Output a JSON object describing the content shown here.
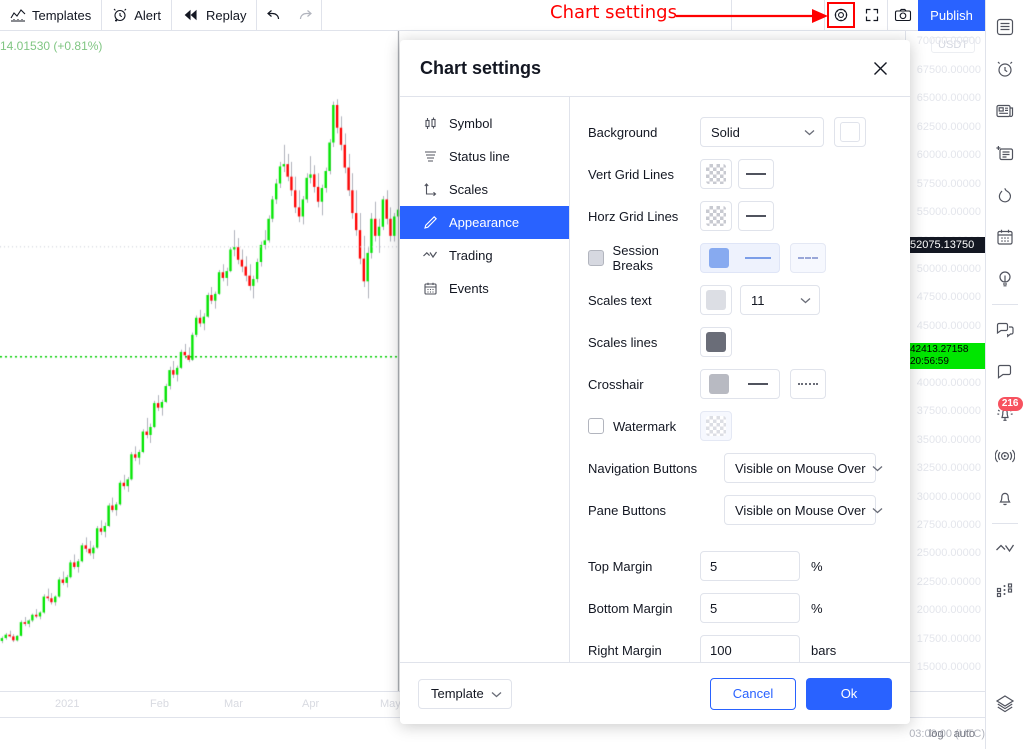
{
  "toolbar": {
    "templates_label": "Templates",
    "alert_label": "Alert",
    "replay_label": "Replay",
    "publish_label": "Publish"
  },
  "annotation": {
    "text": "Chart settings",
    "color": "#ff0000"
  },
  "chart": {
    "ticker_quote": "14.01530 (+0.81%)",
    "quote_color": "#80c683",
    "currency_chip": "USDT",
    "crosshair_price": "52075.13750",
    "last_price": "42413.27158",
    "last_price_time": "20:56:59",
    "last_price_color": "#00e600",
    "log_label": "log",
    "auto_label": "auto",
    "clock_time": "03:03:00 (UTC)"
  },
  "chart_data": {
    "type": "candlestick",
    "title": "",
    "xlabel": "",
    "ylabel": "",
    "ylim": [
      13000,
      71000
    ],
    "y_ticks": [
      "70000.00000",
      "67500.00000",
      "65000.00000",
      "62500.00000",
      "60000.00000",
      "57500.00000",
      "55000.00000",
      "52500.00000",
      "50000.00000",
      "47500.00000",
      "45000.00000",
      "42500.00000",
      "40000.00000",
      "37500.00000",
      "35000.00000",
      "32500.00000",
      "30000.00000",
      "27500.00000",
      "25000.00000",
      "22500.00000",
      "20000.00000",
      "17500.00000",
      "15000.00000"
    ],
    "x_ticks": [
      "2021",
      "Feb",
      "Mar",
      "Apr",
      "May"
    ],
    "up_color": "#00e600",
    "down_color": "#ff0000",
    "candles": [
      [
        17400,
        17800,
        17200,
        17650
      ],
      [
        17650,
        18100,
        17500,
        17950
      ],
      [
        17950,
        18300,
        17700,
        17800
      ],
      [
        17800,
        18000,
        17300,
        17450
      ],
      [
        17450,
        17900,
        17350,
        17850
      ],
      [
        17850,
        19200,
        17800,
        19050
      ],
      [
        19050,
        19500,
        18700,
        18900
      ],
      [
        18900,
        19300,
        18600,
        19200
      ],
      [
        19200,
        19800,
        19050,
        19700
      ],
      [
        19700,
        20200,
        19400,
        19550
      ],
      [
        19550,
        20000,
        19300,
        19900
      ],
      [
        19900,
        21500,
        19800,
        21300
      ],
      [
        21300,
        22000,
        20900,
        21150
      ],
      [
        21150,
        21600,
        20600,
        20800
      ],
      [
        20800,
        21400,
        20500,
        21300
      ],
      [
        21300,
        23000,
        21200,
        22800
      ],
      [
        22800,
        23500,
        22300,
        22500
      ],
      [
        22500,
        23200,
        22100,
        23000
      ],
      [
        23000,
        24500,
        22900,
        24300
      ],
      [
        24300,
        25000,
        23700,
        23900
      ],
      [
        23900,
        24600,
        23400,
        24400
      ],
      [
        24400,
        26000,
        24300,
        25800
      ],
      [
        25800,
        26500,
        25200,
        25500
      ],
      [
        25500,
        26200,
        24900,
        25100
      ],
      [
        25100,
        25800,
        24600,
        25600
      ],
      [
        25600,
        27500,
        25500,
        27300
      ],
      [
        27300,
        28000,
        26700,
        27000
      ],
      [
        27000,
        27800,
        26500,
        27500
      ],
      [
        27500,
        29500,
        27400,
        29300
      ],
      [
        29300,
        30000,
        28700,
        28900
      ],
      [
        28900,
        29600,
        28400,
        29400
      ],
      [
        29400,
        31500,
        29300,
        31300
      ],
      [
        31300,
        32000,
        30700,
        31000
      ],
      [
        31000,
        31800,
        30500,
        31600
      ],
      [
        31600,
        34000,
        31500,
        33800
      ],
      [
        33800,
        34500,
        33200,
        33500
      ],
      [
        33500,
        34200,
        32900,
        34000
      ],
      [
        34000,
        36000,
        33900,
        35800
      ],
      [
        35800,
        37000,
        35200,
        35500
      ],
      [
        35500,
        36500,
        34800,
        36200
      ],
      [
        36200,
        38500,
        36100,
        38300
      ],
      [
        38300,
        39000,
        37600,
        37900
      ],
      [
        37900,
        38600,
        37200,
        38400
      ],
      [
        38400,
        40000,
        38300,
        39800
      ],
      [
        39800,
        41500,
        39500,
        41200
      ],
      [
        41200,
        42000,
        40500,
        40800
      ],
      [
        40800,
        41600,
        40200,
        41400
      ],
      [
        41400,
        43000,
        41300,
        42800
      ],
      [
        42800,
        43500,
        42200,
        42500
      ],
      [
        42500,
        43200,
        41900,
        42100
      ],
      [
        42100,
        44500,
        42000,
        44300
      ],
      [
        44300,
        46000,
        44100,
        45800
      ],
      [
        45800,
        46500,
        45000,
        45300
      ],
      [
        45300,
        46200,
        44700,
        45900
      ],
      [
        45900,
        48000,
        45800,
        47800
      ],
      [
        47800,
        48500,
        47000,
        47300
      ],
      [
        47300,
        48100,
        46600,
        47900
      ],
      [
        47900,
        50000,
        47800,
        49800
      ],
      [
        49800,
        50500,
        49000,
        49300
      ],
      [
        49300,
        50200,
        48600,
        49900
      ],
      [
        49900,
        52000,
        49800,
        51800
      ],
      [
        51800,
        53500,
        51200,
        52000
      ],
      [
        52000,
        52800,
        50500,
        50900
      ],
      [
        50900,
        51800,
        49800,
        50300
      ],
      [
        50300,
        51200,
        49000,
        49500
      ],
      [
        49500,
        50500,
        48200,
        48600
      ],
      [
        48600,
        49500,
        47500,
        49200
      ],
      [
        49200,
        51000,
        48900,
        50700
      ],
      [
        50700,
        52500,
        50300,
        52200
      ],
      [
        52200,
        53500,
        51800,
        52600
      ],
      [
        52600,
        54800,
        52400,
        54500
      ],
      [
        54500,
        56500,
        54200,
        56200
      ],
      [
        56200,
        58000,
        55800,
        57600
      ],
      [
        57600,
        59500,
        57200,
        59100
      ],
      [
        59100,
        61000,
        58600,
        59300
      ],
      [
        59300,
        60200,
        57800,
        58200
      ],
      [
        58200,
        59500,
        56500,
        57000
      ],
      [
        57000,
        58200,
        55000,
        55500
      ],
      [
        55500,
        57000,
        54200,
        54700
      ],
      [
        54700,
        56500,
        54000,
        56200
      ],
      [
        56200,
        58500,
        55900,
        58100
      ],
      [
        58100,
        60000,
        57600,
        58400
      ],
      [
        58400,
        59200,
        56800,
        57300
      ],
      [
        57300,
        58500,
        55500,
        56000
      ],
      [
        56000,
        57500,
        54800,
        57200
      ],
      [
        57200,
        59000,
        56800,
        58700
      ],
      [
        58700,
        61500,
        58400,
        61200
      ],
      [
        61200,
        64800,
        60800,
        64500
      ],
      [
        64500,
        65000,
        62000,
        62500
      ],
      [
        62500,
        63500,
        60500,
        61000
      ],
      [
        61000,
        62000,
        58500,
        59000
      ],
      [
        59000,
        60200,
        56500,
        57000
      ],
      [
        57000,
        58500,
        54500,
        55000
      ],
      [
        55000,
        57000,
        53000,
        53500
      ],
      [
        53500,
        55000,
        50500,
        51000
      ],
      [
        51000,
        53000,
        48500,
        49000
      ],
      [
        49000,
        52000,
        47500,
        51500
      ],
      [
        51500,
        55000,
        51000,
        54500
      ],
      [
        54500,
        56000,
        52500,
        53000
      ],
      [
        53000,
        54500,
        51500,
        53800
      ],
      [
        53800,
        56500,
        53500,
        56200
      ],
      [
        56200,
        57000,
        54000,
        54500
      ],
      [
        54500,
        55500,
        52500,
        53000
      ],
      [
        53000,
        55000,
        52500,
        54700
      ],
      [
        54700,
        56000,
        53800,
        55300
      ]
    ]
  },
  "dialog": {
    "title": "Chart settings",
    "nav": [
      {
        "label": "Symbol",
        "icon": "candle-icon",
        "active": false
      },
      {
        "label": "Status line",
        "icon": "lines-icon",
        "active": false
      },
      {
        "label": "Scales",
        "icon": "axes-icon",
        "active": false
      },
      {
        "label": "Appearance",
        "icon": "pencil-icon",
        "active": true
      },
      {
        "label": "Trading",
        "icon": "trading-icon",
        "active": false
      },
      {
        "label": "Events",
        "icon": "calendar-icon",
        "active": false
      }
    ],
    "settings": {
      "background_label": "Background",
      "background_value": "Solid",
      "background_color": "#ffffff",
      "vert_grid_label": "Vert Grid Lines",
      "horz_grid_label": "Horz Grid Lines",
      "session_breaks_label": "Session Breaks",
      "session_breaks_checked": false,
      "session_breaks_color": "#87aaf0",
      "scales_text_label": "Scales text",
      "scales_text_color": "#dcdee4",
      "scales_text_size": "11",
      "scales_lines_label": "Scales lines",
      "scales_lines_color": "#6a6d78",
      "crosshair_label": "Crosshair",
      "crosshair_color": "#b8bac2",
      "watermark_label": "Watermark",
      "watermark_checked": false,
      "navigation_buttons_label": "Navigation Buttons",
      "navigation_buttons_value": "Visible on Mouse Over",
      "pane_buttons_label": "Pane Buttons",
      "pane_buttons_value": "Visible on Mouse Over",
      "top_margin_label": "Top Margin",
      "top_margin_value": "5",
      "top_margin_unit": "%",
      "bottom_margin_label": "Bottom Margin",
      "bottom_margin_value": "5",
      "bottom_margin_unit": "%",
      "right_margin_label": "Right Margin",
      "right_margin_value": "100",
      "right_margin_unit": "bars"
    },
    "footer": {
      "template_label": "Template",
      "cancel_label": "Cancel",
      "ok_label": "Ok"
    }
  },
  "rightbar": {
    "alert_badge": "216",
    "items": [
      "watchlist-icon",
      "alarm-clock-icon",
      "news-icon",
      "data-window-icon",
      "hotlist-icon",
      "calendar-icon",
      "ideas-icon",
      "chat-icon",
      "private-chat-icon",
      "alerts-log-icon",
      "stream-icon",
      "notifications-icon",
      "trading-panel-icon",
      "object-tree-icon",
      "layers-icon"
    ]
  }
}
